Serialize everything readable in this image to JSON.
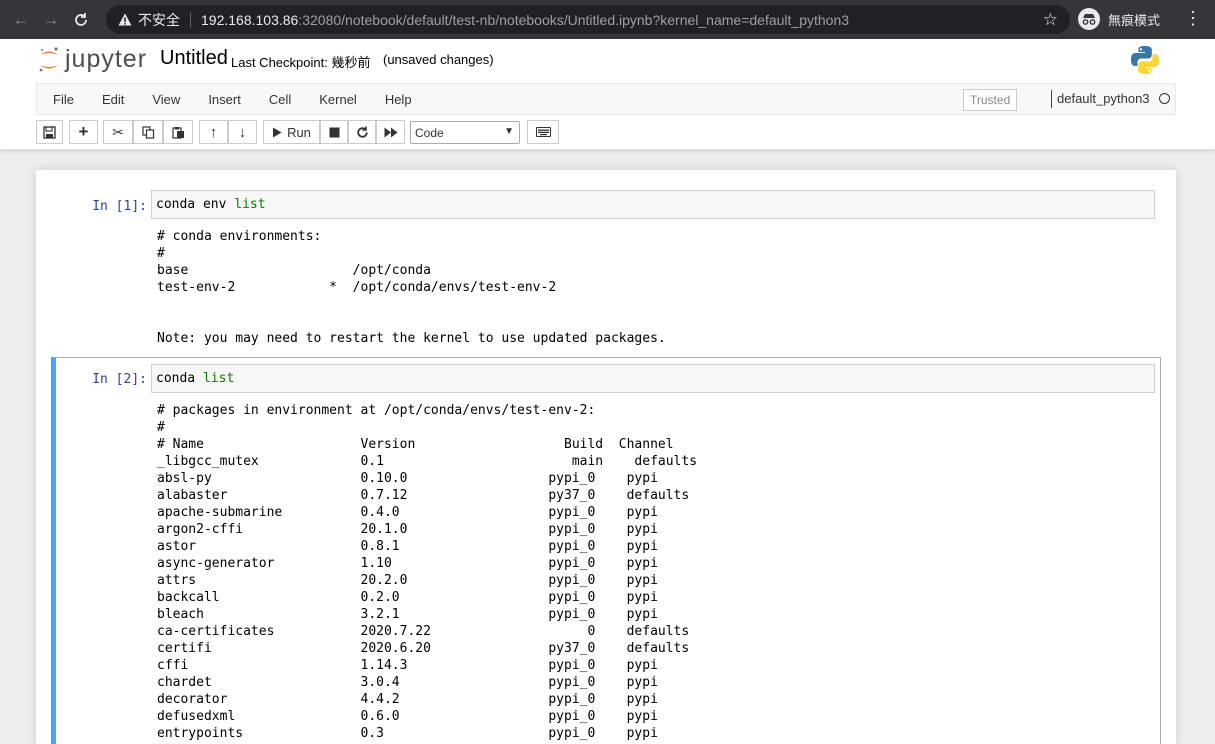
{
  "browser": {
    "insecure_label": "不安全",
    "url_host": "192.168.103.86",
    "url_rest": ":32080/notebook/default/test-nb/notebooks/Untitled.ipynb?kernel_name=default_python3",
    "incognito_label": "無痕模式"
  },
  "header": {
    "logo_text": "jupyter",
    "title": "Untitled",
    "checkpoint": "Last Checkpoint: 幾秒前",
    "unsaved": "(unsaved changes)"
  },
  "menu": {
    "items": [
      "File",
      "Edit",
      "View",
      "Insert",
      "Cell",
      "Kernel",
      "Help"
    ],
    "trusted": "Trusted",
    "kernel": "default_python3"
  },
  "toolbar": {
    "run_label": "Run",
    "cell_type": "Code"
  },
  "cells": [
    {
      "prompt": "In [1]:",
      "code_cmd": "conda env ",
      "code_kw": "list",
      "output": "# conda environments:\n#\nbase                     /opt/conda\ntest-env-2            *  /opt/conda/envs/test-env-2\n\n\nNote: you may need to restart the kernel to use updated packages."
    },
    {
      "prompt": "In [2]:",
      "code_cmd": "conda ",
      "code_kw": "list",
      "output": "# packages in environment at /opt/conda/envs/test-env-2:\n#\n# Name                    Version                   Build  Channel\n_libgcc_mutex             0.1                        main    defaults\nabsl-py                   0.10.0                  pypi_0    pypi\nalabaster                 0.7.12                  py37_0    defaults\napache-submarine          0.4.0                   pypi_0    pypi\nargon2-cffi               20.1.0                  pypi_0    pypi\nastor                     0.8.1                   pypi_0    pypi\nasync-generator           1.10                    pypi_0    pypi\nattrs                     20.2.0                  pypi_0    pypi\nbackcall                  0.2.0                   pypi_0    pypi\nbleach                    3.2.1                   pypi_0    pypi\nca-certificates           2020.7.22                    0    defaults\ncertifi                   2020.6.20               py37_0    defaults\ncffi                      1.14.3                  pypi_0    pypi\nchardet                   3.0.4                   pypi_0    pypi\ndecorator                 4.4.2                   pypi_0    pypi\ndefusedxml                0.6.0                   pypi_0    pypi\nentrypoints               0.3                     pypi_0    pypi"
    }
  ]
}
